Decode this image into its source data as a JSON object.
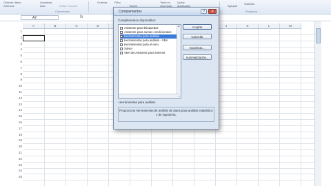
{
  "ribbon": {
    "items": [
      "Obtener datos externos",
      "Actualizar todo",
      "Ordenar",
      "Filtro",
      "Borrar",
      "Texto en columnas",
      "Quitar duplicados",
      "Agrupar",
      "Subtotal"
    ],
    "groups": [
      "Conexiones",
      "Esquema"
    ],
    "edit_links": "Editar vínculos"
  },
  "formula_bar": {
    "name_box": "A2",
    "fx": "fx"
  },
  "sheet": {
    "columns": [
      "A",
      "B",
      "C",
      "D",
      "E",
      "F",
      "G",
      "H",
      "I",
      "J",
      "K",
      "L",
      "M",
      "N"
    ],
    "rows": [
      "1",
      "2",
      "3",
      "4",
      "5",
      "6",
      "7",
      "8",
      "9",
      "10",
      "11",
      "12",
      "13",
      "14",
      "15",
      "16",
      "17",
      "18",
      "19",
      "20",
      "21",
      "22",
      "23",
      "24",
      "25",
      "26"
    ]
  },
  "dialog": {
    "title": "Complementos",
    "title_buttons": {
      "help": "?",
      "close": "X"
    },
    "list_label": "Complementos disponibles:",
    "items": [
      {
        "label": "Asistente para búsquedas",
        "checked": false,
        "selected": false
      },
      {
        "label": "Asistente para sumas condicionales",
        "checked": false,
        "selected": false
      },
      {
        "label": "Herramientas para análisis",
        "checked": false,
        "selected": true
      },
      {
        "label": "Herramientas para análisis - VBA",
        "checked": false,
        "selected": false
      },
      {
        "label": "Herramientas para el euro",
        "checked": false,
        "selected": false
      },
      {
        "label": "Solver",
        "checked": false,
        "selected": false
      },
      {
        "label": "VBA del Asistente para Internet",
        "checked": false,
        "selected": false
      }
    ],
    "buttons": {
      "ok": "Aceptar",
      "cancel": "Cancelar",
      "browse": "Examinar...",
      "automation": "Automatización..."
    },
    "selected_name": "Herramientas para análisis",
    "description": "Proporciona herramientas de análisis de datos para análisis estadístico y de ingeniería."
  }
}
